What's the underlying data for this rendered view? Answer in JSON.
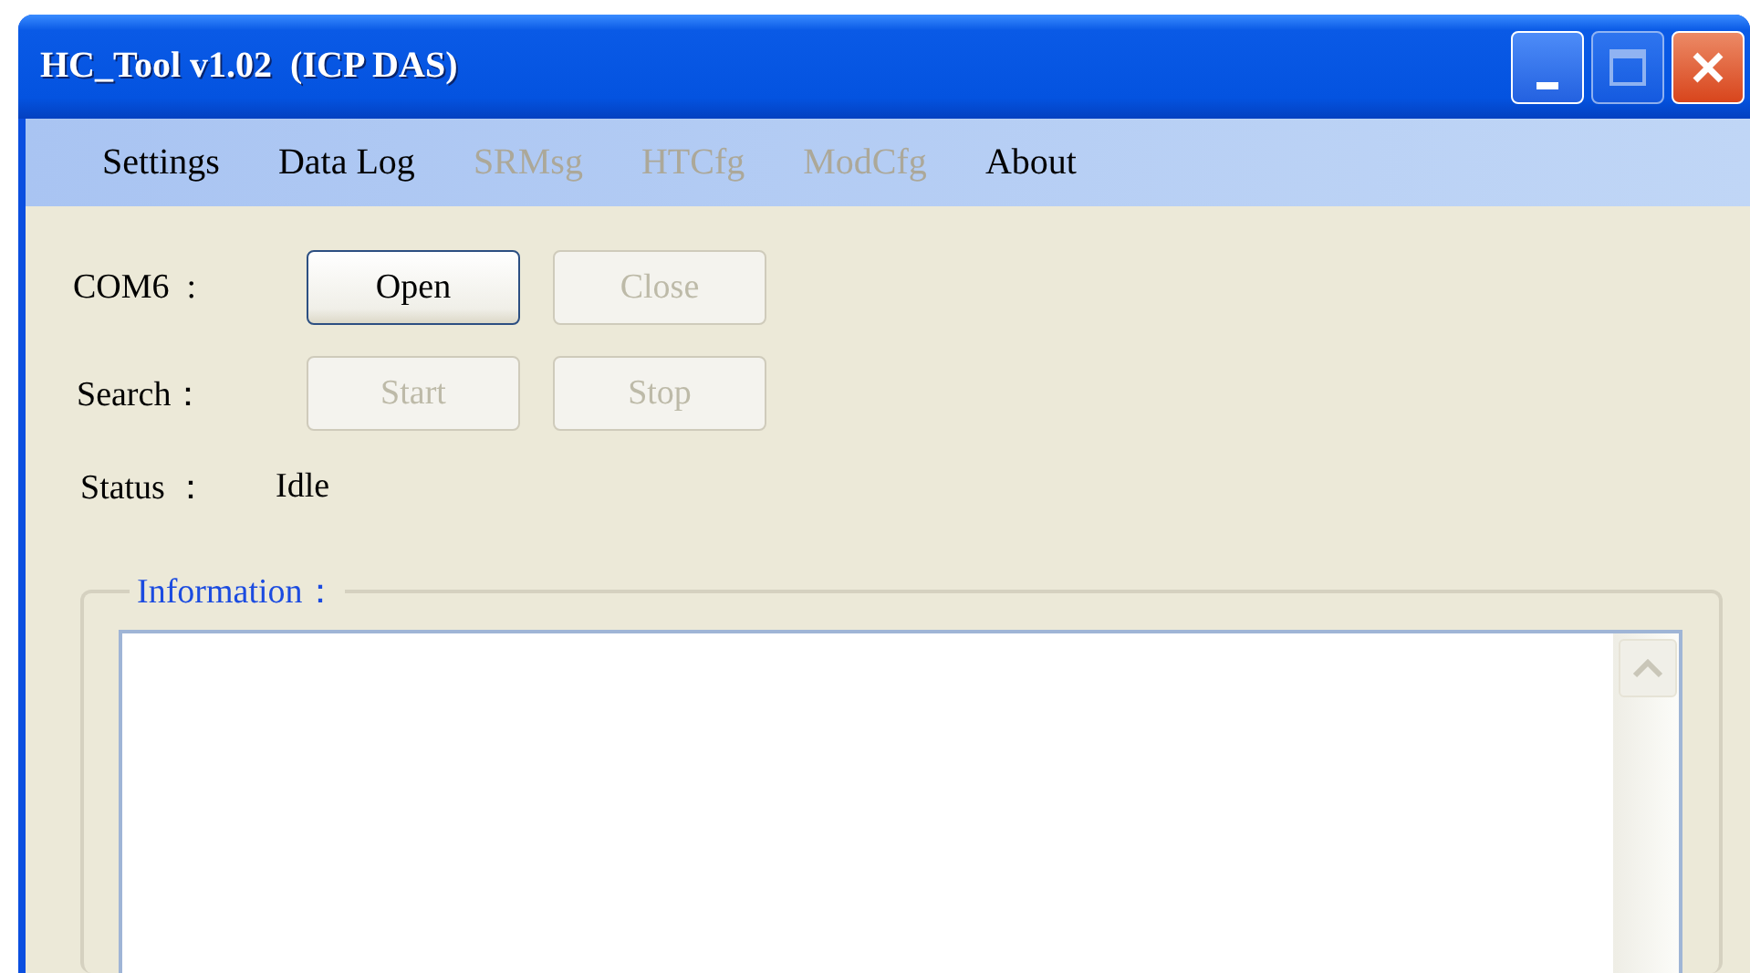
{
  "window": {
    "title": "HC_Tool v1.02  (ICP DAS)",
    "buttons": [
      {
        "kind": "minimize",
        "disabled": false
      },
      {
        "kind": "maximize",
        "disabled": true
      },
      {
        "kind": "close",
        "disabled": false
      }
    ]
  },
  "menu": [
    {
      "label": "Settings",
      "disabled": false
    },
    {
      "label": "Data Log",
      "disabled": false
    },
    {
      "label": "SRMsg",
      "disabled": true
    },
    {
      "label": "HTCfg",
      "disabled": true
    },
    {
      "label": "ModCfg",
      "disabled": true
    },
    {
      "label": "About",
      "disabled": false
    }
  ],
  "port": {
    "label": "COM6  :",
    "buttons": [
      {
        "label": "Open",
        "disabled": false
      },
      {
        "label": "Close",
        "disabled": true
      }
    ]
  },
  "search": {
    "label": "Search：",
    "buttons": [
      {
        "label": "Start",
        "disabled": true
      },
      {
        "label": "Stop",
        "disabled": true
      }
    ]
  },
  "status": {
    "label": "Status ：",
    "value": "Idle"
  },
  "information": {
    "legend": "Information："
  }
}
